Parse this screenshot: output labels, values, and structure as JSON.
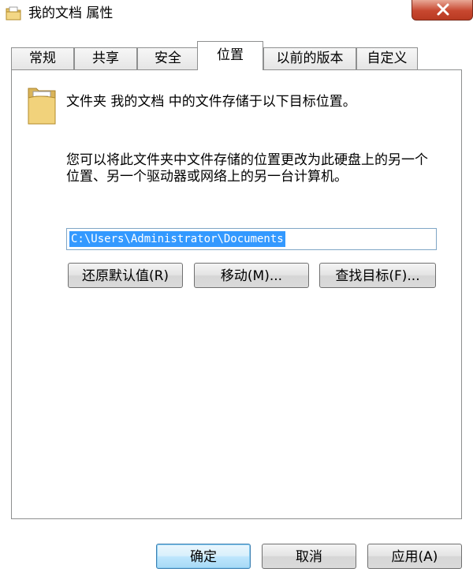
{
  "window": {
    "title": "我的文档 属性",
    "close_label": "关闭"
  },
  "tabs": [
    {
      "label": "常规",
      "active": false
    },
    {
      "label": "共享",
      "active": false
    },
    {
      "label": "安全",
      "active": false
    },
    {
      "label": "位置",
      "active": true
    },
    {
      "label": "以前的版本",
      "active": false
    },
    {
      "label": "自定义",
      "active": false
    }
  ],
  "location": {
    "description_line1": "文件夹 我的文档 中的文件存储于以下目标位置。",
    "description_line2": "您可以将此文件夹中文件存储的位置更改为此硬盘上的另一个位置、另一个驱动器或网络上的另一台计算机。",
    "path_value": "C:\\Users\\Administrator\\Documents",
    "restore_default_label": "还原默认值(R)",
    "move_label": "移动(M)...",
    "find_target_label": "查找目标(F)..."
  },
  "footer": {
    "ok_label": "确定",
    "cancel_label": "取消",
    "apply_label": "应用(A)"
  },
  "colors": {
    "selection": "#3399ff",
    "close_button": "#c7472f",
    "primary_button_border": "#3c7fb1"
  },
  "icons": {
    "title_icon": "folder-documents-icon",
    "close_icon": "close-x-icon",
    "large_folder": "folder-documents-icon"
  }
}
